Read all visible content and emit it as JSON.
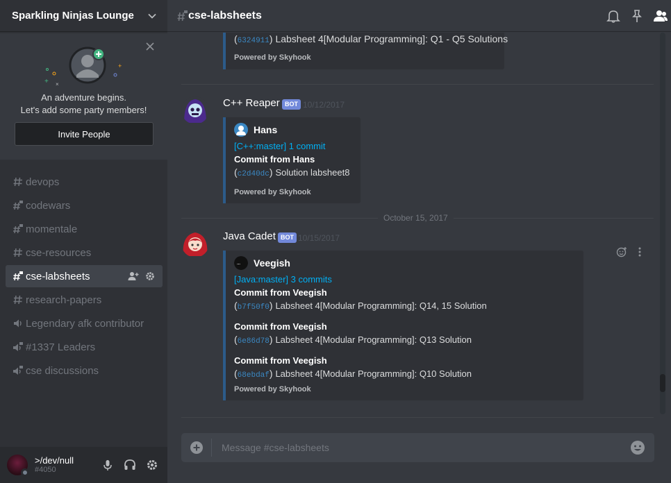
{
  "server": {
    "name": "Sparkling Ninjas Lounge"
  },
  "invite": {
    "line1": "An adventure begins.",
    "line2": "Let's add some party members!",
    "button": "Invite People"
  },
  "channels": [
    {
      "name": "devops",
      "icon": "hash-icon"
    },
    {
      "name": "codewars",
      "icon": "locked-hash-icon"
    },
    {
      "name": "momentale",
      "icon": "locked-hash-icon"
    },
    {
      "name": "cse-resources",
      "icon": "hash-icon"
    },
    {
      "name": "cse-labsheets",
      "icon": "locked-hash-icon",
      "active": true
    },
    {
      "name": "research-papers",
      "icon": "hash-icon"
    },
    {
      "name": "Legendary afk contributor",
      "icon": "speaker-icon"
    },
    {
      "name": "#1337 Leaders",
      "icon": "locked-speaker-icon"
    },
    {
      "name": "cse discussions",
      "icon": "locked-speaker-icon"
    }
  ],
  "user": {
    "name": ">/dev/null",
    "tag": "#4050"
  },
  "header": {
    "channel_title": "cse-labsheets"
  },
  "messages": {
    "top_embed": {
      "hash": "6324911",
      "text": "Labsheet 4[Modular Programming]: Q1 - Q5 Solutions",
      "footer": "Powered by Skyhook"
    },
    "msg1": {
      "author": "C++ Reaper",
      "badge": "BOT",
      "time": "10/12/2017",
      "embed_author": "Hans",
      "link": "[C++:master] 1 commit",
      "commits": [
        {
          "title": "Commit from Hans",
          "hash": "c2d40dc",
          "text": "Solution labsheet8"
        }
      ],
      "footer": "Powered by Skyhook"
    },
    "date_divider": "October 15, 2017",
    "msg2": {
      "author": "Java Cadet",
      "badge": "BOT",
      "time": "10/15/2017",
      "embed_author": "Veegish",
      "link": "[Java:master] 3 commits",
      "commits": [
        {
          "title": "Commit from Veegish",
          "hash": "b7f50f0",
          "text": "Labsheet 4[Modular Programming]: Q14, 15 Solution"
        },
        {
          "title": "Commit from Veegish",
          "hash": "6e86d78",
          "text": "Labsheet 4[Modular Programming]: Q13 Solution"
        },
        {
          "title": "Commit from Veegish",
          "hash": "68ebdaf",
          "text": "Labsheet 4[Modular Programming]: Q10 Solution"
        }
      ],
      "footer": "Powered by Skyhook"
    }
  },
  "composer": {
    "placeholder": "Message #cse-labsheets"
  },
  "colors": {
    "accent": "#7289da",
    "link": "#00b0f4",
    "embed_border": "#2c5b8a",
    "online": "#43b581"
  }
}
